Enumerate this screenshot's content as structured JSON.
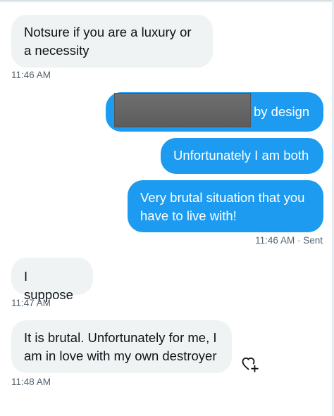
{
  "conversation": {
    "msg1": {
      "text": "Notsure if you are a luxury or a necessity",
      "time": "11:46 AM"
    },
    "msg2": {
      "text": "by design",
      "redacted": true
    },
    "msg3": {
      "text": "Unfortunately I am both"
    },
    "msg4": {
      "text": "Very brutal situation that you have to live with!"
    },
    "msg4_status": {
      "time": "11:46 AM",
      "status": "· Sent"
    },
    "msg5": {
      "text": "I suppose",
      "time": "11:47 AM"
    },
    "msg6": {
      "text": "It is brutal. Unfortunately for me, I am in love with my own destroyer",
      "time": "11:48 AM"
    }
  },
  "icons": {
    "react": "add-reaction-heart-icon"
  },
  "colors": {
    "outgoing_bubble": "#1d9bf0",
    "incoming_bubble": "#eff3f4",
    "timestamp": "#536471"
  }
}
